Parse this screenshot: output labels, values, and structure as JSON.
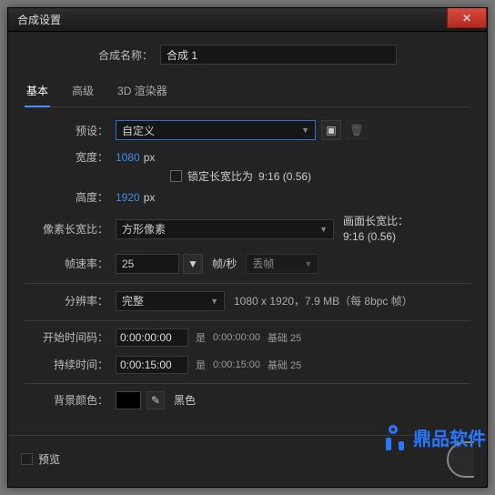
{
  "window": {
    "title": "合成设置"
  },
  "compName": {
    "label": "合成名称：",
    "value": "合成 1"
  },
  "tabs": {
    "basic": "基本",
    "advanced": "高级",
    "renderer": "3D 渲染器"
  },
  "preset": {
    "label": "预设：",
    "value": "自定义"
  },
  "width": {
    "label": "宽度：",
    "value": "1080",
    "unit": "px"
  },
  "height": {
    "label": "高度：",
    "value": "1920",
    "unit": "px"
  },
  "lockAspect": {
    "label": "锁定长宽比为",
    "ratio": "9:16 (0.56)"
  },
  "par": {
    "label": "像素长宽比：",
    "value": "方形像素"
  },
  "frameAspect": {
    "label": "画面长宽比：",
    "value": "9:16 (0.56)"
  },
  "fps": {
    "label": "帧速率：",
    "value": "25",
    "unit": "帧/秒",
    "drop": "丢帧"
  },
  "res": {
    "label": "分辨率：",
    "value": "完整",
    "info": "1080 x 1920，7.9 MB（每 8bpc 帧）"
  },
  "start": {
    "label": "开始时间码：",
    "value": "0:00:00:00",
    "is": "是",
    "tc": "0:00:00:00",
    "base": "基础 25"
  },
  "dur": {
    "label": "持续时间：",
    "value": "0:00:15:00",
    "is": "是",
    "tc": "0:00:15:00",
    "base": "基础 25"
  },
  "bg": {
    "label": "背景颜色：",
    "name": "黑色"
  },
  "footer": {
    "preview": "预览"
  },
  "wm": "鼎品软件"
}
